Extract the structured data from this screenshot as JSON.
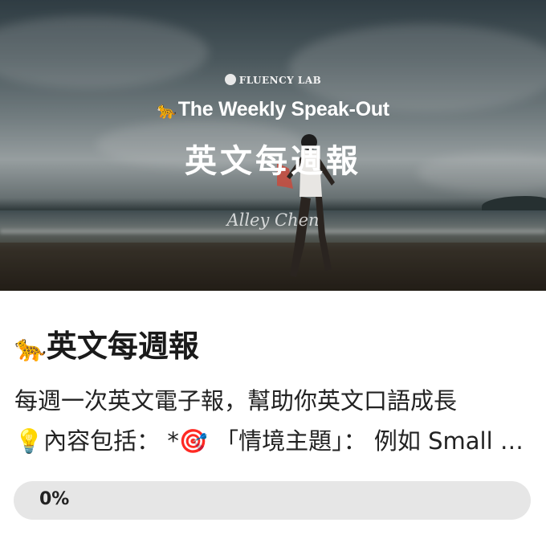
{
  "banner": {
    "brand": "FLUENCY LAB",
    "subtitle_emoji": "🐆",
    "subtitle": "The Weekly Speak-Out",
    "title_cn": "英文每週報",
    "signature": "Alley Chen"
  },
  "card": {
    "title_emoji": "🐆",
    "title": "英文每週報",
    "description_line1": "每週一次英文電子報，幫助你英文口語成長",
    "description_line2": "💡內容包括： *🎯 「情境主題」： 例如 Small talk..."
  },
  "progress": {
    "value_percent": 0,
    "label": "0%"
  }
}
